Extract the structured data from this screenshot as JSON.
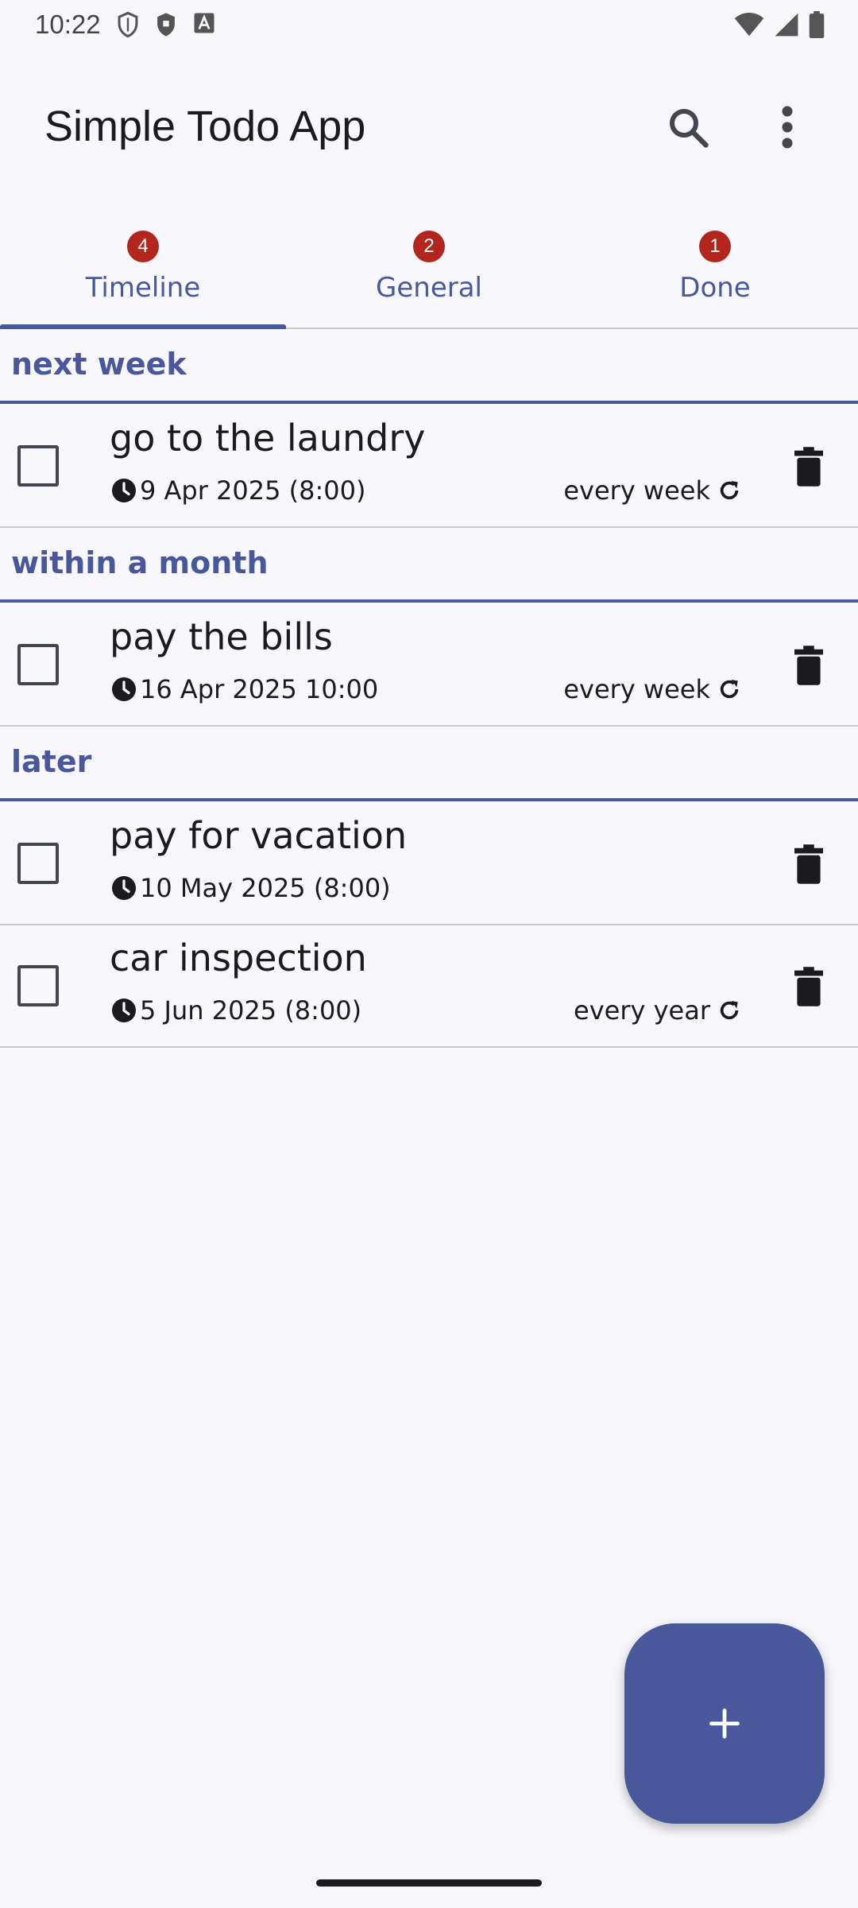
{
  "status_bar": {
    "time": "10:22",
    "icons_left": [
      "shield-outline-icon",
      "shield-filled-icon",
      "font-a-icon"
    ],
    "icons_right": [
      "wifi-icon",
      "cellular-signal-icon",
      "battery-icon"
    ]
  },
  "app_bar": {
    "title": "Simple Todo App",
    "actions": [
      "search-icon",
      "more-vert-icon"
    ]
  },
  "tabs": [
    {
      "label": "Timeline",
      "badge": "4",
      "selected": true
    },
    {
      "label": "General",
      "badge": "2",
      "selected": false
    },
    {
      "label": "Done",
      "badge": "1",
      "selected": false
    }
  ],
  "sections": [
    {
      "title": "next week",
      "items": [
        {
          "title": "go to the laundry",
          "date": "9 Apr 2025 (8:00)",
          "repeat": "every week"
        }
      ]
    },
    {
      "title": "within a month",
      "items": [
        {
          "title": "pay the bills",
          "date": "16 Apr 2025 10:00",
          "repeat": "every week"
        }
      ]
    },
    {
      "title": "later",
      "items": [
        {
          "title": "pay for vacation",
          "date": "10 May 2025 (8:00)",
          "repeat": ""
        },
        {
          "title": "car inspection",
          "date": "5 Jun 2025 (8:00)",
          "repeat": "every year"
        }
      ]
    }
  ],
  "fab": {
    "icon": "add-icon"
  },
  "colors": {
    "primary": "#48589a",
    "badge": "#b3261e",
    "background": "#f8f8fc",
    "divider": "#c8c8cf"
  }
}
